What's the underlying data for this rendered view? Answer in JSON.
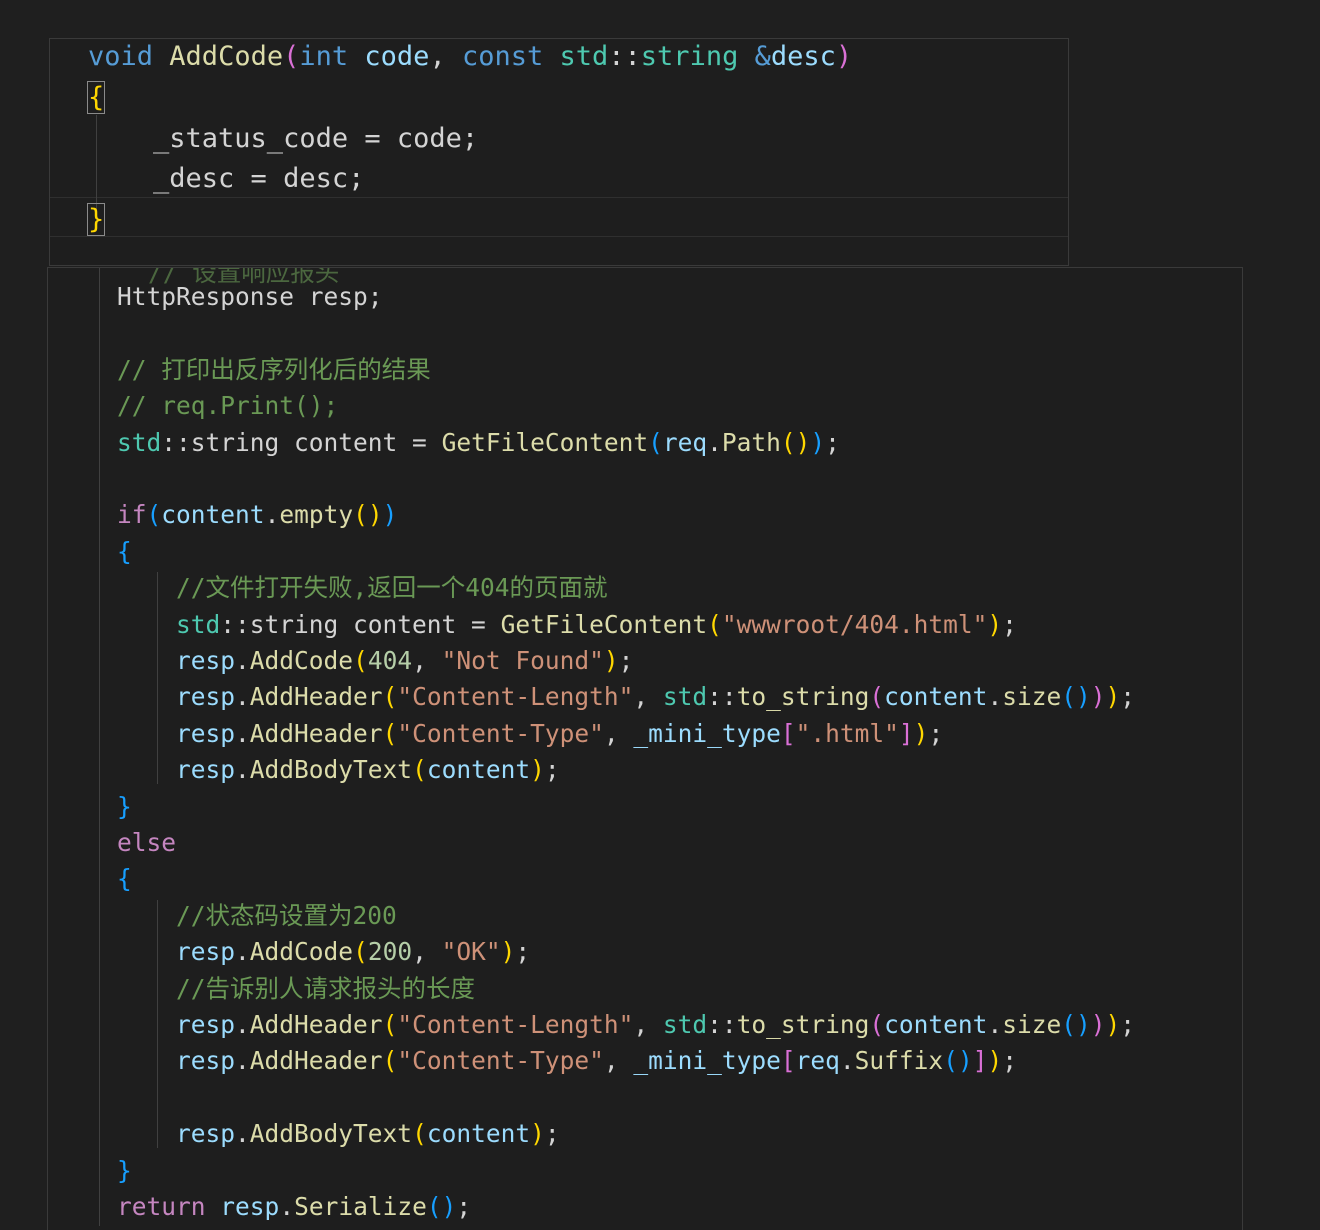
{
  "top_editor": {
    "lines": [
      [
        {
          "t": "void",
          "c": "kw"
        },
        {
          "t": " ",
          "c": "pun"
        },
        {
          "t": "AddCode",
          "c": "fn"
        },
        {
          "t": "(",
          "c": "br2"
        },
        {
          "t": "int",
          "c": "kw"
        },
        {
          "t": " ",
          "c": "pun"
        },
        {
          "t": "code",
          "c": "var"
        },
        {
          "t": ", ",
          "c": "pun"
        },
        {
          "t": "const",
          "c": "kw"
        },
        {
          "t": " ",
          "c": "pun"
        },
        {
          "t": "std",
          "c": "ty"
        },
        {
          "t": "::",
          "c": "pun"
        },
        {
          "t": "string",
          "c": "ty"
        },
        {
          "t": " ",
          "c": "pun"
        },
        {
          "t": "&",
          "c": "kw"
        },
        {
          "t": "desc",
          "c": "var"
        },
        {
          "t": ")",
          "c": "br2"
        }
      ],
      [
        {
          "t": "{",
          "c": "br1"
        }
      ],
      [
        {
          "t": "    _status_code = code;",
          "c": "pun"
        }
      ],
      [
        {
          "t": "    _desc = desc;",
          "c": "pun"
        }
      ],
      [
        {
          "t": "}",
          "c": "br1"
        }
      ]
    ]
  },
  "main_editor": {
    "clipped_line": "// 设置响应报头",
    "lines": [
      [
        {
          "t": "    HttpResponse resp;",
          "c": "pun"
        }
      ],
      [],
      [
        {
          "t": "    // 打印出反序列化后的结果",
          "c": "cmt"
        }
      ],
      [
        {
          "t": "    // req.Print();",
          "c": "cmt"
        }
      ],
      [
        {
          "t": "    ",
          "c": "pun"
        },
        {
          "t": "std",
          "c": "ty"
        },
        {
          "t": "::",
          "c": "pun"
        },
        {
          "t": "string content = ",
          "c": "pun"
        },
        {
          "t": "GetFileContent",
          "c": "fn"
        },
        {
          "t": "(",
          "c": "br3"
        },
        {
          "t": "req",
          "c": "var"
        },
        {
          "t": ".",
          "c": "pun"
        },
        {
          "t": "Path",
          "c": "fn"
        },
        {
          "t": "()",
          "c": "br1"
        },
        {
          "t": ")",
          "c": "br3"
        },
        {
          "t": ";",
          "c": "pun"
        }
      ],
      [],
      [
        {
          "t": "    ",
          "c": "pun"
        },
        {
          "t": "if",
          "c": "ctl"
        },
        {
          "t": "(",
          "c": "br3"
        },
        {
          "t": "content",
          "c": "var"
        },
        {
          "t": ".",
          "c": "pun"
        },
        {
          "t": "empty",
          "c": "fn"
        },
        {
          "t": "()",
          "c": "br1"
        },
        {
          "t": ")",
          "c": "br3"
        }
      ],
      [
        {
          "t": "    ",
          "c": "pun"
        },
        {
          "t": "{",
          "c": "br3"
        }
      ],
      [
        {
          "t": "        //文件打开失败,返回一个404的页面就",
          "c": "cmt"
        }
      ],
      [
        {
          "t": "        ",
          "c": "pun"
        },
        {
          "t": "std",
          "c": "ty"
        },
        {
          "t": "::",
          "c": "pun"
        },
        {
          "t": "string content = ",
          "c": "pun"
        },
        {
          "t": "GetFileContent",
          "c": "fn"
        },
        {
          "t": "(",
          "c": "br1"
        },
        {
          "t": "\"wwwroot/404.html\"",
          "c": "str"
        },
        {
          "t": ")",
          "c": "br1"
        },
        {
          "t": ";",
          "c": "pun"
        }
      ],
      [
        {
          "t": "        ",
          "c": "pun"
        },
        {
          "t": "resp",
          "c": "var"
        },
        {
          "t": ".",
          "c": "pun"
        },
        {
          "t": "AddCode",
          "c": "fn"
        },
        {
          "t": "(",
          "c": "br1"
        },
        {
          "t": "404",
          "c": "num"
        },
        {
          "t": ", ",
          "c": "pun"
        },
        {
          "t": "\"Not Found\"",
          "c": "str"
        },
        {
          "t": ")",
          "c": "br1"
        },
        {
          "t": ";",
          "c": "pun"
        }
      ],
      [
        {
          "t": "        ",
          "c": "pun"
        },
        {
          "t": "resp",
          "c": "var"
        },
        {
          "t": ".",
          "c": "pun"
        },
        {
          "t": "AddHeader",
          "c": "fn"
        },
        {
          "t": "(",
          "c": "br1"
        },
        {
          "t": "\"Content-Length\"",
          "c": "str"
        },
        {
          "t": ", ",
          "c": "pun"
        },
        {
          "t": "std",
          "c": "ty"
        },
        {
          "t": "::",
          "c": "pun"
        },
        {
          "t": "to_string",
          "c": "fn"
        },
        {
          "t": "(",
          "c": "br2"
        },
        {
          "t": "content",
          "c": "var"
        },
        {
          "t": ".",
          "c": "pun"
        },
        {
          "t": "size",
          "c": "fn"
        },
        {
          "t": "()",
          "c": "br3"
        },
        {
          "t": ")",
          "c": "br2"
        },
        {
          "t": ")",
          "c": "br1"
        },
        {
          "t": ";",
          "c": "pun"
        }
      ],
      [
        {
          "t": "        ",
          "c": "pun"
        },
        {
          "t": "resp",
          "c": "var"
        },
        {
          "t": ".",
          "c": "pun"
        },
        {
          "t": "AddHeader",
          "c": "fn"
        },
        {
          "t": "(",
          "c": "br1"
        },
        {
          "t": "\"Content-Type\"",
          "c": "str"
        },
        {
          "t": ", ",
          "c": "pun"
        },
        {
          "t": "_mini_type",
          "c": "var"
        },
        {
          "t": "[",
          "c": "br2"
        },
        {
          "t": "\".html\"",
          "c": "str"
        },
        {
          "t": "]",
          "c": "br2"
        },
        {
          "t": ")",
          "c": "br1"
        },
        {
          "t": ";",
          "c": "pun"
        }
      ],
      [
        {
          "t": "        ",
          "c": "pun"
        },
        {
          "t": "resp",
          "c": "var"
        },
        {
          "t": ".",
          "c": "pun"
        },
        {
          "t": "AddBodyText",
          "c": "fn"
        },
        {
          "t": "(",
          "c": "br1"
        },
        {
          "t": "content",
          "c": "var"
        },
        {
          "t": ")",
          "c": "br1"
        },
        {
          "t": ";",
          "c": "pun"
        }
      ],
      [
        {
          "t": "    ",
          "c": "pun"
        },
        {
          "t": "}",
          "c": "br3"
        }
      ],
      [
        {
          "t": "    ",
          "c": "pun"
        },
        {
          "t": "else",
          "c": "ctl"
        }
      ],
      [
        {
          "t": "    ",
          "c": "pun"
        },
        {
          "t": "{",
          "c": "br3"
        }
      ],
      [
        {
          "t": "        //状态码设置为200",
          "c": "cmt"
        }
      ],
      [
        {
          "t": "        ",
          "c": "pun"
        },
        {
          "t": "resp",
          "c": "var"
        },
        {
          "t": ".",
          "c": "pun"
        },
        {
          "t": "AddCode",
          "c": "fn"
        },
        {
          "t": "(",
          "c": "br1"
        },
        {
          "t": "200",
          "c": "num"
        },
        {
          "t": ", ",
          "c": "pun"
        },
        {
          "t": "\"OK\"",
          "c": "str"
        },
        {
          "t": ")",
          "c": "br1"
        },
        {
          "t": ";",
          "c": "pun"
        }
      ],
      [
        {
          "t": "        //告诉别人请求报头的长度",
          "c": "cmt"
        }
      ],
      [
        {
          "t": "        ",
          "c": "pun"
        },
        {
          "t": "resp",
          "c": "var"
        },
        {
          "t": ".",
          "c": "pun"
        },
        {
          "t": "AddHeader",
          "c": "fn"
        },
        {
          "t": "(",
          "c": "br1"
        },
        {
          "t": "\"Content-Length\"",
          "c": "str"
        },
        {
          "t": ", ",
          "c": "pun"
        },
        {
          "t": "std",
          "c": "ty"
        },
        {
          "t": "::",
          "c": "pun"
        },
        {
          "t": "to_string",
          "c": "fn"
        },
        {
          "t": "(",
          "c": "br2"
        },
        {
          "t": "content",
          "c": "var"
        },
        {
          "t": ".",
          "c": "pun"
        },
        {
          "t": "size",
          "c": "fn"
        },
        {
          "t": "()",
          "c": "br3"
        },
        {
          "t": ")",
          "c": "br2"
        },
        {
          "t": ")",
          "c": "br1"
        },
        {
          "t": ";",
          "c": "pun"
        }
      ],
      [
        {
          "t": "        ",
          "c": "pun"
        },
        {
          "t": "resp",
          "c": "var"
        },
        {
          "t": ".",
          "c": "pun"
        },
        {
          "t": "AddHeader",
          "c": "fn"
        },
        {
          "t": "(",
          "c": "br1"
        },
        {
          "t": "\"Content-Type\"",
          "c": "str"
        },
        {
          "t": ", ",
          "c": "pun"
        },
        {
          "t": "_mini_type",
          "c": "var"
        },
        {
          "t": "[",
          "c": "br2"
        },
        {
          "t": "req",
          "c": "var"
        },
        {
          "t": ".",
          "c": "pun"
        },
        {
          "t": "Suffix",
          "c": "fn"
        },
        {
          "t": "()",
          "c": "br3"
        },
        {
          "t": "]",
          "c": "br2"
        },
        {
          "t": ")",
          "c": "br1"
        },
        {
          "t": ";",
          "c": "pun"
        }
      ],
      [],
      [
        {
          "t": "        ",
          "c": "pun"
        },
        {
          "t": "resp",
          "c": "var"
        },
        {
          "t": ".",
          "c": "pun"
        },
        {
          "t": "AddBodyText",
          "c": "fn"
        },
        {
          "t": "(",
          "c": "br1"
        },
        {
          "t": "content",
          "c": "var"
        },
        {
          "t": ")",
          "c": "br1"
        },
        {
          "t": ";",
          "c": "pun"
        }
      ],
      [
        {
          "t": "    ",
          "c": "pun"
        },
        {
          "t": "}",
          "c": "br3"
        }
      ],
      [
        {
          "t": "    ",
          "c": "pun"
        },
        {
          "t": "return",
          "c": "ctl"
        },
        {
          "t": " ",
          "c": "pun"
        },
        {
          "t": "resp",
          "c": "var"
        },
        {
          "t": ".",
          "c": "pun"
        },
        {
          "t": "Serialize",
          "c": "fn"
        },
        {
          "t": "()",
          "c": "br3"
        },
        {
          "t": ";",
          "c": "pun"
        }
      ]
    ]
  }
}
